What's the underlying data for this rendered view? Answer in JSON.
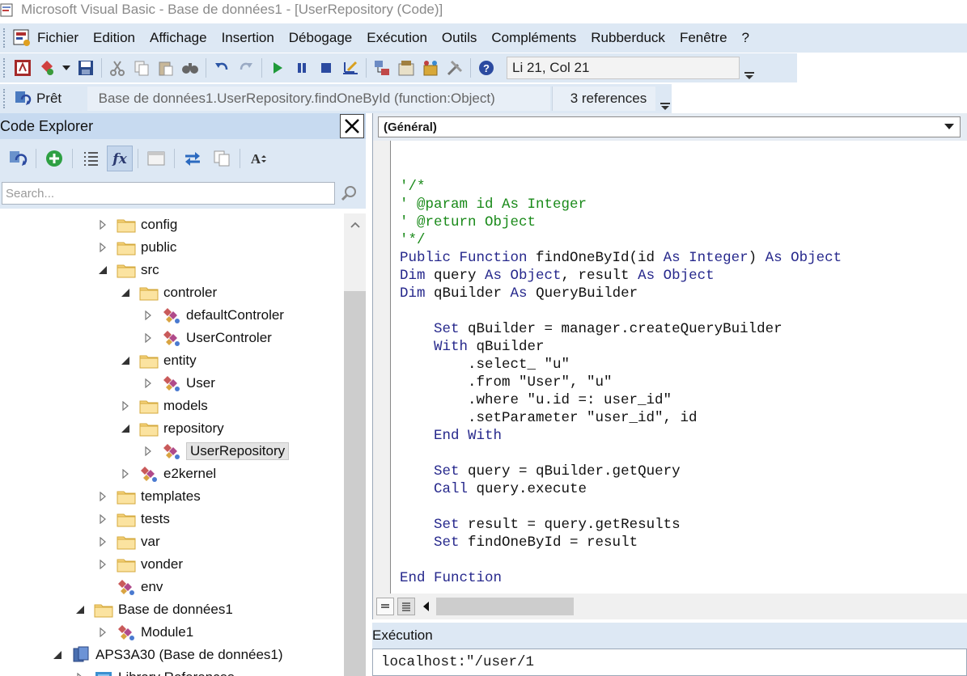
{
  "window": {
    "title": "Microsoft Visual Basic - Base de données1 - [UserRepository (Code)]"
  },
  "menu": {
    "items": [
      "Fichier",
      "Edition",
      "Affichage",
      "Insertion",
      "Débogage",
      "Exécution",
      "Outils",
      "Compléments",
      "Rubberduck",
      "Fenêtre",
      "?"
    ]
  },
  "toolbar": {
    "position": "Li 21, Col 21",
    "icons": [
      "access-icon",
      "insert-module-icon",
      "save-icon",
      "cut-icon",
      "copy-icon",
      "paste-icon",
      "find-icon",
      "undo-icon",
      "redo-icon",
      "run-icon",
      "break-icon",
      "reset-icon",
      "design-mode-icon",
      "project-explorer-icon",
      "properties-icon",
      "object-browser-icon",
      "toolbox-icon",
      "help-icon"
    ]
  },
  "rubberduck_bar": {
    "status": "Prêt",
    "selection": "Base de données1.UserRepository.findOneById (function:Object)",
    "references": "3 references"
  },
  "explorer": {
    "title": "Code Explorer",
    "search_placeholder": "Search...",
    "tree": [
      {
        "label": "config",
        "indent": 2,
        "expander": "collapsed",
        "icon": "folder"
      },
      {
        "label": "public",
        "indent": 2,
        "expander": "collapsed",
        "icon": "folder"
      },
      {
        "label": "src",
        "indent": 2,
        "expander": "expanded",
        "icon": "folder"
      },
      {
        "label": "controler",
        "indent": 3,
        "expander": "expanded",
        "icon": "folder"
      },
      {
        "label": "defaultControler",
        "indent": 4,
        "expander": "collapsed",
        "icon": "class"
      },
      {
        "label": "UserControler",
        "indent": 4,
        "expander": "collapsed",
        "icon": "class"
      },
      {
        "label": "entity",
        "indent": 3,
        "expander": "expanded",
        "icon": "folder"
      },
      {
        "label": "User",
        "indent": 4,
        "expander": "collapsed",
        "icon": "class"
      },
      {
        "label": "models",
        "indent": 3,
        "expander": "collapsed",
        "icon": "folder"
      },
      {
        "label": "repository",
        "indent": 3,
        "expander": "expanded",
        "icon": "folder"
      },
      {
        "label": "UserRepository",
        "indent": 4,
        "expander": "collapsed",
        "icon": "class",
        "selected": true
      },
      {
        "label": "e2kernel",
        "indent": 3,
        "expander": "collapsed",
        "icon": "class"
      },
      {
        "label": "templates",
        "indent": 2,
        "expander": "collapsed",
        "icon": "folder"
      },
      {
        "label": "tests",
        "indent": 2,
        "expander": "collapsed",
        "icon": "folder"
      },
      {
        "label": "var",
        "indent": 2,
        "expander": "collapsed",
        "icon": "folder"
      },
      {
        "label": "vonder",
        "indent": 2,
        "expander": "collapsed",
        "icon": "folder"
      },
      {
        "label": "env",
        "indent": 2,
        "expander": "none",
        "icon": "class"
      },
      {
        "label": "Base de données1",
        "indent": 1,
        "expander": "expanded",
        "icon": "folder"
      },
      {
        "label": "Module1",
        "indent": 2,
        "expander": "collapsed",
        "icon": "class"
      },
      {
        "label": "APS3A30 (Base de données1)",
        "indent": 0,
        "expander": "expanded",
        "icon": "project"
      },
      {
        "label": "Library References",
        "indent": 1,
        "expander": "collapsed",
        "icon": "library"
      }
    ]
  },
  "code_window": {
    "procedure": "(Général)",
    "lines": [
      [],
      [
        {
          "t": "'/*",
          "c": "cm"
        }
      ],
      [
        {
          "t": "' @param id As Integer",
          "c": "cm"
        }
      ],
      [
        {
          "t": "' @return Object",
          "c": "cm"
        }
      ],
      [
        {
          "t": "'*/",
          "c": "cm"
        }
      ],
      [
        {
          "t": "Public Function",
          "c": "kw"
        },
        {
          "t": " findOneById(id "
        },
        {
          "t": "As Integer",
          "c": "kw"
        },
        {
          "t": ") "
        },
        {
          "t": "As Object",
          "c": "kw"
        }
      ],
      [
        {
          "t": "Dim",
          "c": "kw"
        },
        {
          "t": " query "
        },
        {
          "t": "As Object",
          "c": "kw"
        },
        {
          "t": ", result "
        },
        {
          "t": "As Object",
          "c": "kw"
        }
      ],
      [
        {
          "t": "Dim",
          "c": "kw"
        },
        {
          "t": " qBuilder "
        },
        {
          "t": "As",
          "c": "kw"
        },
        {
          "t": " QueryBuilder"
        }
      ],
      [],
      [
        {
          "t": "    "
        },
        {
          "t": "Set",
          "c": "kw"
        },
        {
          "t": " qBuilder = manager.createQueryBuilder"
        }
      ],
      [
        {
          "t": "    "
        },
        {
          "t": "With",
          "c": "kw"
        },
        {
          "t": " qBuilder"
        }
      ],
      [
        {
          "t": "        .select_ \"u\""
        }
      ],
      [
        {
          "t": "        .from \"User\", \"u\""
        }
      ],
      [
        {
          "t": "        .where \"u.id =: user_id\""
        }
      ],
      [
        {
          "t": "        .setParameter \"user_id\", id"
        }
      ],
      [
        {
          "t": "    "
        },
        {
          "t": "End With",
          "c": "kw"
        }
      ],
      [],
      [
        {
          "t": "    "
        },
        {
          "t": "Set",
          "c": "kw"
        },
        {
          "t": " query = qBuilder.getQuery"
        }
      ],
      [
        {
          "t": "    "
        },
        {
          "t": "Call",
          "c": "kw"
        },
        {
          "t": " query.execute"
        }
      ],
      [],
      [
        {
          "t": "    "
        },
        {
          "t": "Set",
          "c": "kw"
        },
        {
          "t": " result = query.getResults"
        }
      ],
      [
        {
          "t": "    "
        },
        {
          "t": "Set",
          "c": "kw"
        },
        {
          "t": " findOneById = result"
        }
      ],
      [],
      [
        {
          "t": "End Function",
          "c": "kw"
        }
      ]
    ]
  },
  "immediate": {
    "title": "Exécution",
    "content": "localhost:\"/user/1"
  }
}
